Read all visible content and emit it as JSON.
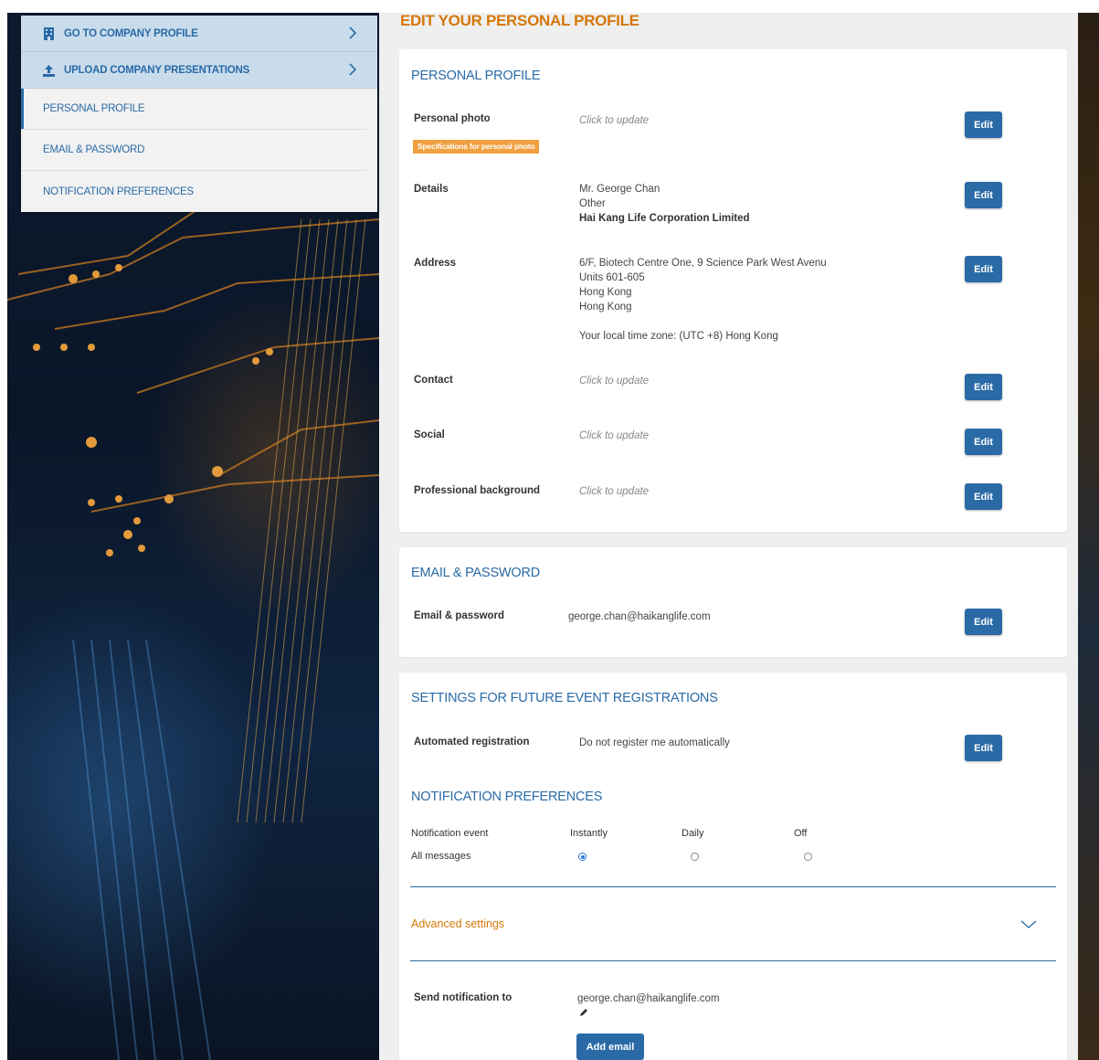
{
  "sidebar": {
    "links": [
      {
        "label": "GO TO COMPANY PROFILE",
        "icon": "building-icon"
      },
      {
        "label": "UPLOAD COMPANY PRESENTATIONS",
        "icon": "upload-icon"
      }
    ],
    "items": [
      {
        "label": "PERSONAL PROFILE",
        "active": true
      },
      {
        "label": "EMAIL & PASSWORD",
        "active": false
      },
      {
        "label": "NOTIFICATION PREFERENCES",
        "active": false
      }
    ]
  },
  "page_title": "EDIT YOUR PERSONAL PROFILE",
  "personal_profile": {
    "title": "PERSONAL PROFILE",
    "edit_label": "Edit",
    "photo": {
      "label": "Personal photo",
      "value": "Click to update",
      "badge": "Specifications for personal photo"
    },
    "details": {
      "label": "Details",
      "lines": [
        "Mr. George Chan",
        "Other",
        "Hai Kang Life Corporation Limited"
      ]
    },
    "address": {
      "label": "Address",
      "lines": [
        "6/F, Biotech Centre One, 9 Science Park West Avenu",
        "Units 601-605",
        "Hong Kong",
        "Hong Kong"
      ],
      "timezone": "Your local time zone: (UTC +8) Hong Kong"
    },
    "contact": {
      "label": "Contact",
      "value": "Click to update"
    },
    "social": {
      "label": "Social",
      "value": "Click to update"
    },
    "professional": {
      "label": "Professional background",
      "value": "Click to update"
    }
  },
  "email_password": {
    "title": "EMAIL & PASSWORD",
    "label": "Email & password",
    "value": "george.chan@haikanglife.com",
    "edit_label": "Edit"
  },
  "future_events": {
    "title": "SETTINGS FOR FUTURE EVENT REGISTRATIONS",
    "label": "Automated registration",
    "value": "Do not register me automatically",
    "edit_label": "Edit"
  },
  "notifications": {
    "title": "NOTIFICATION PREFERENCES",
    "columns": [
      "Notification event",
      "Instantly",
      "Daily",
      "Off"
    ],
    "rows": [
      {
        "event": "All messages",
        "selected": "Instantly"
      }
    ],
    "advanced_label": "Advanced settings",
    "send_to_label": "Send notification to",
    "send_to_value": "george.chan@haikanglife.com",
    "add_email_label": "Add email"
  },
  "colors": {
    "accent": "#2a6aa6",
    "orange": "#d4780a",
    "badge": "#f0a040"
  }
}
